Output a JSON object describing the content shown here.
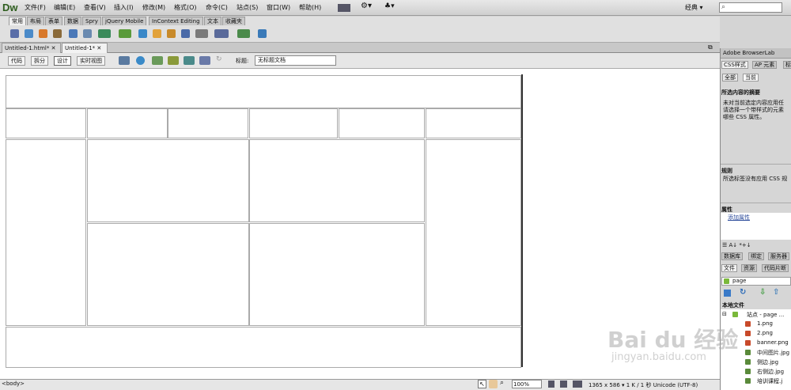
{
  "app": {
    "logo": "Dw",
    "workspace": "经典 ▾"
  },
  "menu": [
    "文件(F)",
    "编辑(E)",
    "查看(V)",
    "插入(I)",
    "修改(M)",
    "格式(O)",
    "命令(C)",
    "站点(S)",
    "窗口(W)",
    "帮助(H)"
  ],
  "insert_tabs": [
    "常用",
    "布局",
    "表单",
    "数据",
    "Spry",
    "jQuery Mobile",
    "InContext Editing",
    "文本",
    "收藏夹"
  ],
  "doc_tabs": [
    "Untitled-1.html*",
    "Untitled-1*"
  ],
  "views": [
    "代码",
    "拆分",
    "设计",
    "实时视图"
  ],
  "title_label": "标题:",
  "title_value": "无标题文档",
  "status": {
    "tag": "<body>",
    "zoom": "100%",
    "info": "1365 x 586 ▾ 1 K / 1 秒 Unicode (UTF-8)"
  },
  "panel": {
    "browserlab": "Adobe BrowserLab",
    "css_tabs": [
      "CSS样式",
      "AP 元素",
      "标"
    ],
    "mode_tabs": [
      "全部",
      "当前"
    ],
    "summary_title": "所选内容的摘要",
    "summary_lines": [
      "未对当前选定内容应用任",
      "请选择一个带样式的元素",
      "哪些 CSS 属性。"
    ],
    "rules_title": "规则",
    "rules_text": "所选标签没有应用 CSS 规",
    "props_title": "属性",
    "add_prop": "添加属性",
    "db_tabs": [
      "数据库",
      "绑定",
      "服务器"
    ],
    "file_tabs": [
      "文件",
      "资源",
      "代码片断"
    ],
    "site_select": "page",
    "local_title": "本地文件",
    "tree_root": "站点 - page ...",
    "files": [
      "1.png",
      "2.png",
      "banner.png",
      "中间图片.jpg",
      "侧边.jpg",
      "右侧边.jpg",
      "培训课程.j"
    ]
  },
  "watermark": {
    "brand": "Bai du 经验",
    "url": "jingyan.baidu.com"
  }
}
